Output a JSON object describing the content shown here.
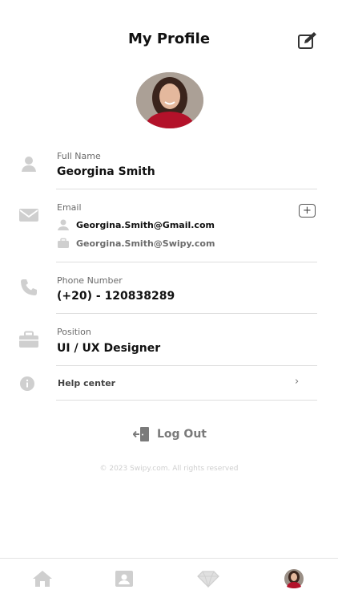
{
  "header": {
    "title": "My Profile"
  },
  "fields": {
    "full_name": {
      "label": "Full Name",
      "value": "Georgina Smith"
    },
    "email": {
      "label": "Email",
      "primary": "Georgina.Smith@Gmail.com",
      "secondary": "Georgina.Smith@Swipy.com",
      "add_label": "+"
    },
    "phone": {
      "label": "Phone Number",
      "value": "(+20) - 120838289"
    },
    "position": {
      "label": "Position",
      "value": "UI / UX Designer"
    }
  },
  "help": {
    "label": "Help center",
    "chevron": "›"
  },
  "logout": {
    "label": "Log Out"
  },
  "footer": {
    "copyright": "© 2023 Swipy.com. All rights reserved"
  },
  "tabs": [
    {
      "name": "home",
      "icon": "home-icon"
    },
    {
      "name": "contacts",
      "icon": "id-card-icon"
    },
    {
      "name": "premium",
      "icon": "diamond-icon"
    },
    {
      "name": "profile",
      "icon": "avatar"
    }
  ],
  "colors": {
    "icon_gray": "#cfcfcf",
    "text_dark": "#111111",
    "text_muted": "#6b6b6b",
    "divider": "#dedede"
  }
}
